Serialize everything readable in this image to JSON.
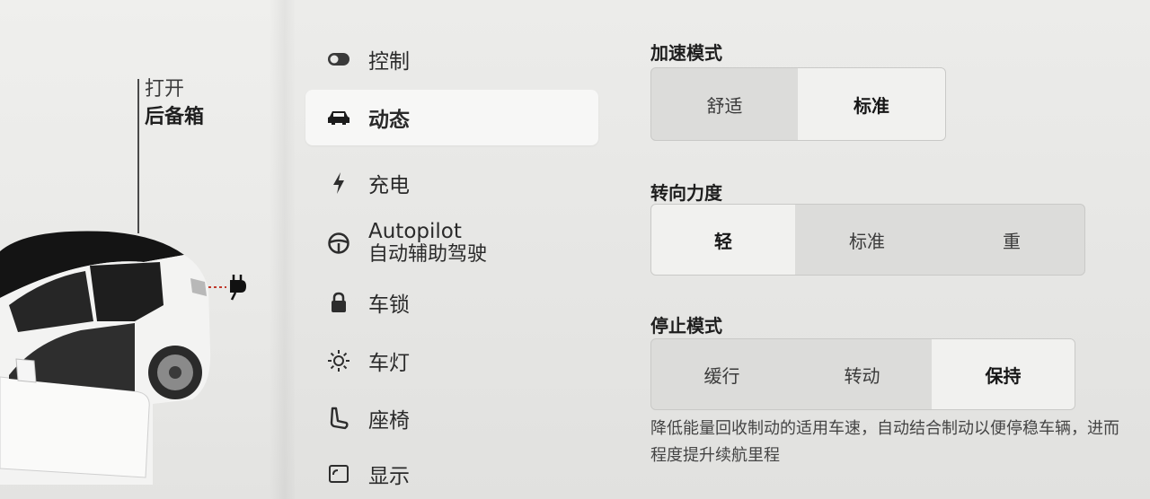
{
  "car": {
    "trunk_open_label": "打开",
    "trunk_name_label": "后备箱"
  },
  "nav": {
    "items": [
      {
        "label": "控制",
        "icon": "toggle-icon",
        "active": false
      },
      {
        "label": "动态",
        "icon": "car-icon",
        "active": true
      },
      {
        "label": "充电",
        "icon": "bolt-icon",
        "active": false
      },
      {
        "label": "Autopilot",
        "sub": "自动辅助驾驶",
        "icon": "steering-wheel-icon",
        "active": false
      },
      {
        "label": "车锁",
        "icon": "lock-icon",
        "active": false
      },
      {
        "label": "车灯",
        "icon": "sun-icon",
        "active": false
      },
      {
        "label": "座椅",
        "icon": "seat-icon",
        "active": false
      },
      {
        "label": "显示",
        "icon": "display-icon",
        "active": false
      }
    ]
  },
  "settings": {
    "acceleration": {
      "title": "加速模式",
      "options": [
        "舒适",
        "标准"
      ],
      "selected": "标准"
    },
    "steering": {
      "title": "转向力度",
      "options": [
        "轻",
        "标准",
        "重"
      ],
      "selected": "轻"
    },
    "stopping": {
      "title": "停止模式",
      "options": [
        "缓行",
        "转动",
        "保持"
      ],
      "selected": "保持",
      "description_line1": "降低能量回收制动的适用车速，自动结合制动以便停稳车辆，进而",
      "description_line2": "程度提升续航里程"
    }
  },
  "colors": {
    "selected_segment": "#f1f1ef",
    "segment_track": "#dcdcda",
    "active_nav": "#f7f7f6"
  }
}
